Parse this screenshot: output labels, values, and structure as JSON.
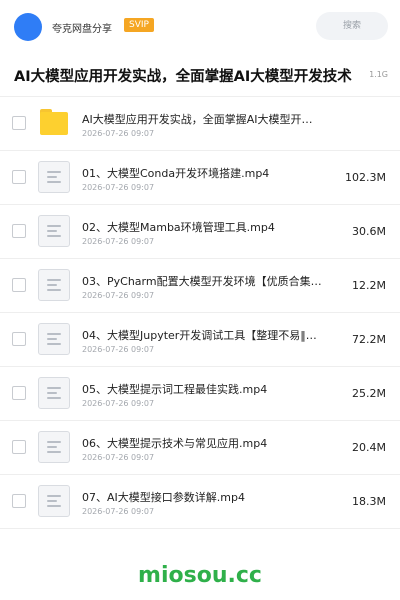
{
  "header": {
    "share_name": "夸克网盘分享",
    "badge": "SVIP",
    "search_placeholder": "搜索"
  },
  "folder": {
    "title": "AI大模型应用开发实战，全面掌握AI大模型开发技术",
    "total_size": "1.1G"
  },
  "items": [
    {
      "name": "AI大模型应用开发实战，全面掌握AI大模型开发技术",
      "date": "2026-07-26 09:07",
      "size": "",
      "type": "folder-icon"
    },
    {
      "name": "01、大模型Conda开发环境搭建.mp4",
      "date": "2026-07-26 09:07",
      "size": "102.3M",
      "type": "file-icon"
    },
    {
      "name": "02、大模型Mamba环境管理工具.mp4",
      "date": "2026-07-26 09:07",
      "size": "30.6M",
      "type": "file-icon"
    },
    {
      "name": "03、PyCharm配置大模型开发环境【优质合集‖…",
      "date": "2026-07-26 09:07",
      "size": "12.2M",
      "type": "file-icon"
    },
    {
      "name": "04、大模型Jupyter开发调试工具【整理不易‖…",
      "date": "2026-07-26 09:07",
      "size": "72.2M",
      "type": "file-icon"
    },
    {
      "name": "05、大模型提示词工程最佳实践.mp4",
      "date": "2026-07-26 09:07",
      "size": "25.2M",
      "type": "file-icon"
    },
    {
      "name": "06、大模型提示技术与常见应用.mp4",
      "date": "2026-07-26 09:07",
      "size": "20.4M",
      "type": "file-icon"
    },
    {
      "name": "07、AI大模型接口参数详解.mp4",
      "date": "2026-07-26 09:07",
      "size": "18.3M",
      "type": "file-icon"
    }
  ],
  "watermark": "miosou.cc",
  "colors": {
    "accent": "#2f7df6",
    "badge": "#f5a623",
    "folder": "#fdd02f",
    "watermark": "#2fb04a"
  }
}
